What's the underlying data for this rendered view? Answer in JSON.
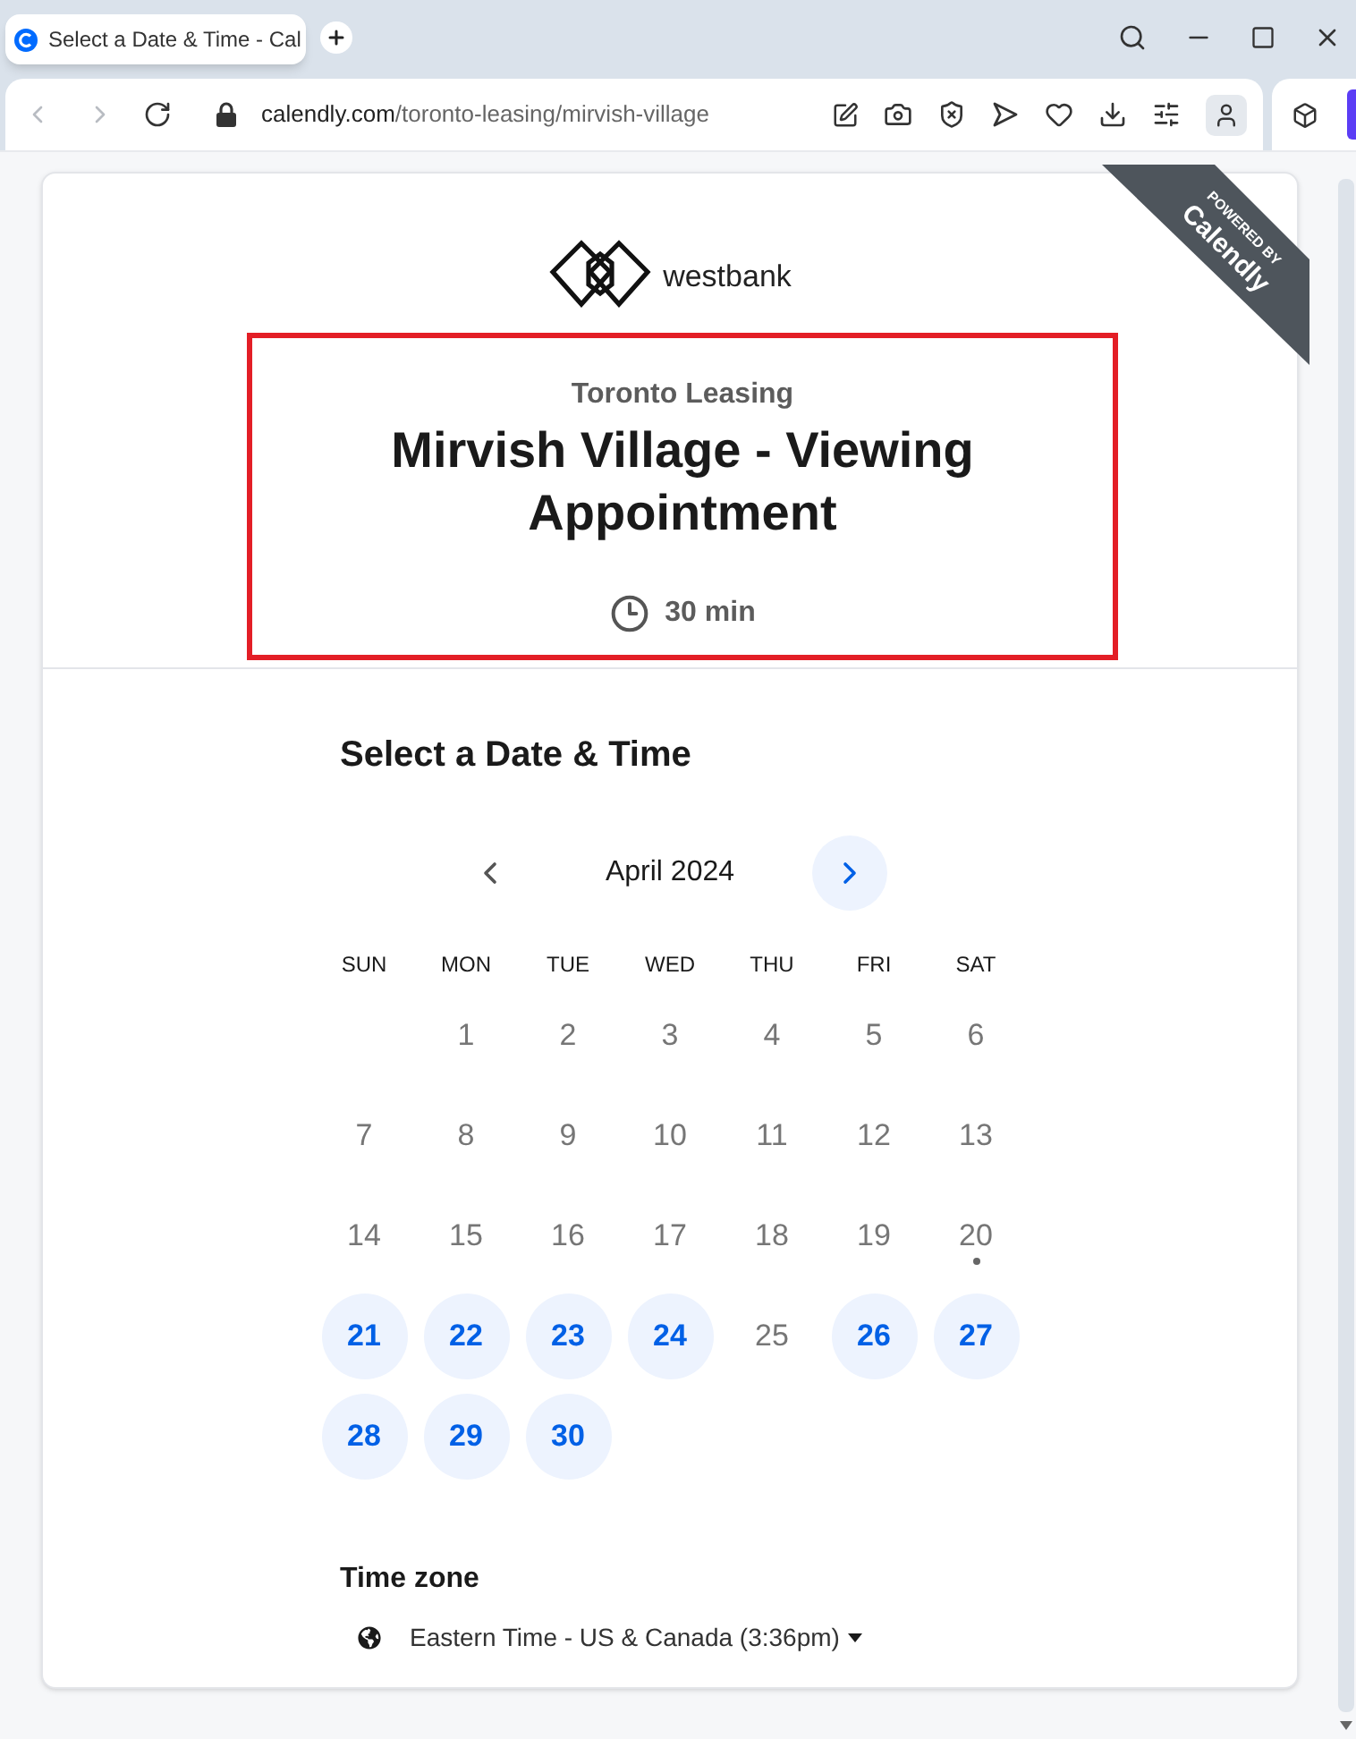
{
  "browser": {
    "tab": {
      "title": "Select a Date & Time - Cal"
    },
    "address_bar": {
      "domain": "calendly.com",
      "path": "/toronto-leasing/mirvish-village"
    }
  },
  "ribbon": {
    "caption": "POWERED BY",
    "brand": "Calendly"
  },
  "logo": {
    "name": "westbank"
  },
  "event": {
    "organizer": "Toronto Leasing",
    "title": "Mirvish Village - Viewing Appointment",
    "duration": "30 min"
  },
  "calendar": {
    "heading": "Select a Date & Time",
    "month": "April 2024",
    "previous_month": {
      "disabled": true
    },
    "next_month": {
      "disabled": false
    },
    "weekdays": [
      "SUN",
      "MON",
      "TUE",
      "WED",
      "THU",
      "FRI",
      "SAT"
    ],
    "weeks": [
      [
        {
          "kind": "date",
          "label": "1",
          "available": false
        },
        {
          "kind": "date",
          "label": "2",
          "available": false
        },
        {
          "kind": "date",
          "label": "3",
          "available": false
        },
        {
          "kind": "date",
          "label": "4",
          "available": false
        },
        {
          "kind": "date",
          "label": "5",
          "available": false
        },
        {
          "kind": "date",
          "label": "6",
          "available": false
        }
      ],
      [
        {
          "kind": "date",
          "label": "7",
          "available": false
        },
        {
          "kind": "date",
          "label": "8",
          "available": false
        },
        {
          "kind": "date",
          "label": "9",
          "available": false
        },
        {
          "kind": "date",
          "label": "10",
          "available": false
        },
        {
          "kind": "date",
          "label": "11",
          "available": false
        },
        {
          "kind": "date",
          "label": "12",
          "available": false
        },
        {
          "kind": "date",
          "label": "13",
          "available": false
        }
      ],
      [
        {
          "kind": "date",
          "label": "14",
          "available": false
        },
        {
          "kind": "date",
          "label": "15",
          "available": false
        },
        {
          "kind": "date",
          "label": "16",
          "available": false
        },
        {
          "kind": "date",
          "label": "17",
          "available": false
        },
        {
          "kind": "date",
          "label": "18",
          "available": false
        },
        {
          "kind": "date",
          "label": "19",
          "available": false
        },
        {
          "kind": "today",
          "label": "20",
          "available": false
        }
      ],
      [
        {
          "kind": "date",
          "label": "21",
          "available": true
        },
        {
          "kind": "date",
          "label": "22",
          "available": true
        },
        {
          "kind": "date",
          "label": "23",
          "available": true
        },
        {
          "kind": "date",
          "label": "24",
          "available": true
        },
        {
          "kind": "date",
          "label": "25",
          "available": false
        },
        {
          "kind": "date",
          "label": "26",
          "available": true
        },
        {
          "kind": "date",
          "label": "27",
          "available": true
        }
      ],
      [
        {
          "kind": "date",
          "label": "28",
          "available": true
        },
        {
          "kind": "date",
          "label": "29",
          "available": true
        },
        {
          "kind": "date",
          "label": "30",
          "available": true
        }
      ]
    ]
  },
  "time_zone": {
    "label": "Time zone",
    "value": "Eastern Time - US & Canada (3:36pm)"
  }
}
